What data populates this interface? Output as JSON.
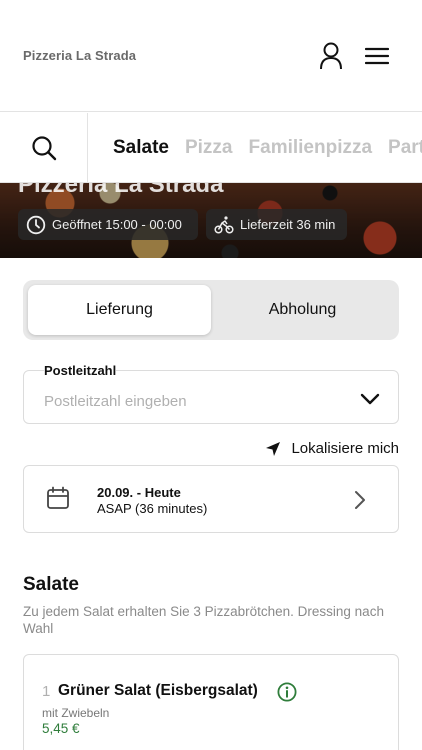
{
  "header": {
    "brand": "Pizzeria La Strada"
  },
  "categories": [
    {
      "label": "Salate",
      "active": true
    },
    {
      "label": "Pizza",
      "active": false
    },
    {
      "label": "Familienpizza",
      "active": false
    },
    {
      "label": "Party",
      "active": false
    }
  ],
  "hero": {
    "title": "Pizzeria La Strada",
    "opening": "Geöffnet 15:00 - 00:00",
    "delivery_time": "Lieferzeit 36 min"
  },
  "order_mode": {
    "delivery": "Lieferung",
    "pickup": "Abholung",
    "selected": "Lieferung"
  },
  "postcode": {
    "label": "Postleitzahl",
    "placeholder": "Postleitzahl eingeben",
    "value": ""
  },
  "locate": {
    "label": "Lokalisiere mich"
  },
  "schedule": {
    "date": "20.09. - Heute",
    "time": "ASAP (36 minutes)"
  },
  "section": {
    "title": "Salate",
    "description": "Zu jedem Salat erhalten Sie 3 Pizzabrötchen. Dressing nach Wahl"
  },
  "products": [
    {
      "number": "1",
      "name": "Grüner Salat (Eisbergsalat)",
      "subtitle": "mit Zwiebeln",
      "price": "5,45 €"
    }
  ],
  "colors": {
    "accent_green": "#2f7d3b",
    "text": "#111111",
    "muted": "#8a8a8a"
  }
}
